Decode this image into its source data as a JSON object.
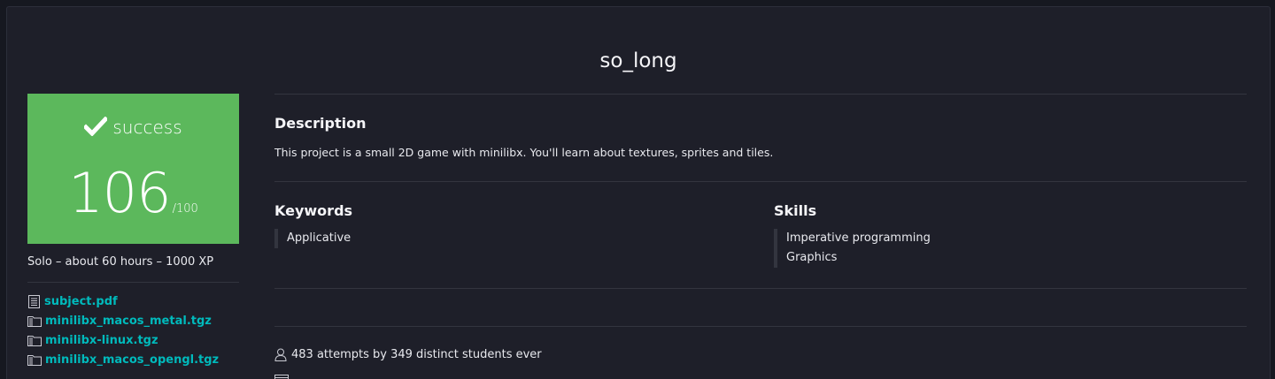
{
  "project": {
    "title": "so_long"
  },
  "status": {
    "label": "success",
    "score": "106",
    "score_max": "/100",
    "color": "#5cb85c"
  },
  "meta": {
    "summary": "Solo – about 60 hours – 1000 XP"
  },
  "files": [
    {
      "name": "subject.pdf",
      "icon": "document-icon"
    },
    {
      "name": "minilibx_macos_metal.tgz",
      "icon": "archive-icon"
    },
    {
      "name": "minilibx-linux.tgz",
      "icon": "archive-icon"
    },
    {
      "name": "minilibx_macos_opengl.tgz",
      "icon": "archive-icon"
    }
  ],
  "description": {
    "heading": "Description",
    "text": "This project is a small 2D game with minilibx. You'll learn about textures, sprites and tiles."
  },
  "keywords": {
    "heading": "Keywords",
    "items": [
      "Applicative"
    ]
  },
  "skills": {
    "heading": "Skills",
    "items": [
      "Imperative programming",
      "Graphics"
    ]
  },
  "stats": {
    "attempts": "483 attempts by 349 distinct students ever",
    "icon": "user-icon"
  },
  "colors": {
    "accent_link": "#00babc",
    "panel_bg": "#1e1f29",
    "page_bg": "#161820"
  }
}
